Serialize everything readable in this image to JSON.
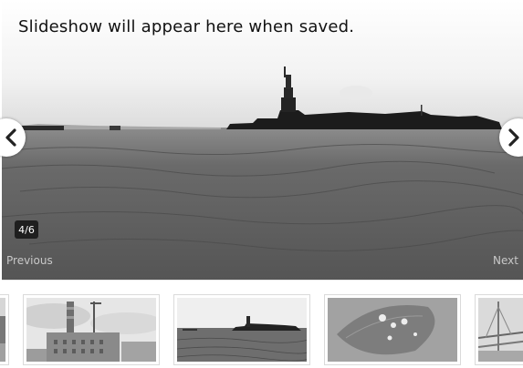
{
  "slideshow": {
    "notice": "Slideshow will appear here when saved.",
    "counter": "4/6",
    "previous_label": "Previous",
    "next_label": "Next"
  },
  "thumbnails": [
    {
      "name": "thumb-partial-left"
    },
    {
      "name": "thumb-chimney-factory"
    },
    {
      "name": "thumb-statue-of-liberty"
    },
    {
      "name": "thumb-water-droplets"
    },
    {
      "name": "thumb-partial-right"
    }
  ]
}
